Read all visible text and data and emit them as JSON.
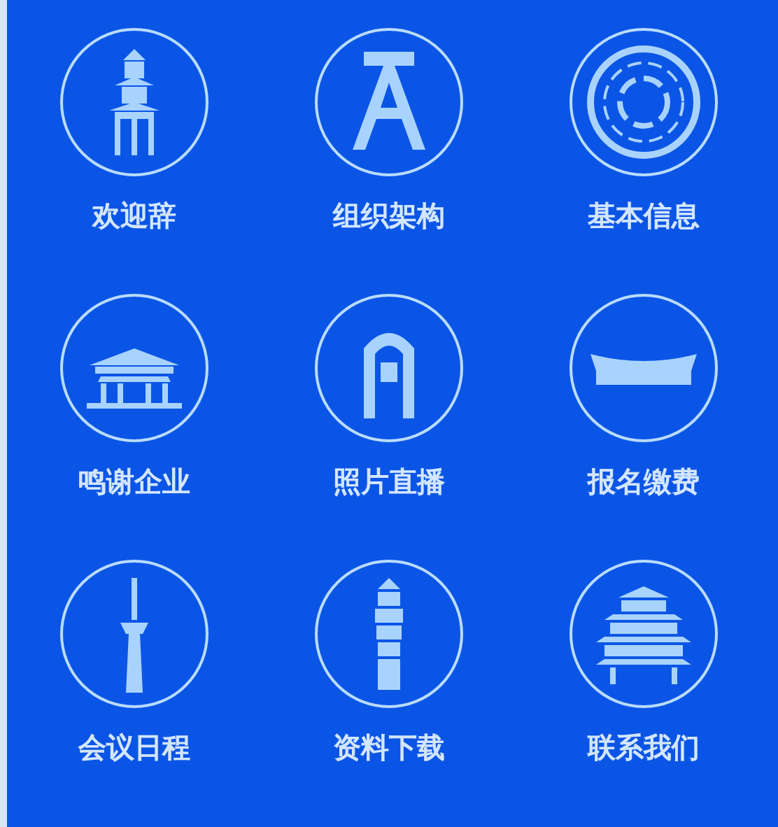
{
  "menu": [
    {
      "label": "欢迎辞"
    },
    {
      "label": "组织架构"
    },
    {
      "label": "基本信息"
    },
    {
      "label": "鸣谢企业"
    },
    {
      "label": "照片直播"
    },
    {
      "label": "报名缴费"
    },
    {
      "label": "会议日程"
    },
    {
      "label": "资料下载"
    },
    {
      "label": "联系我们"
    }
  ]
}
